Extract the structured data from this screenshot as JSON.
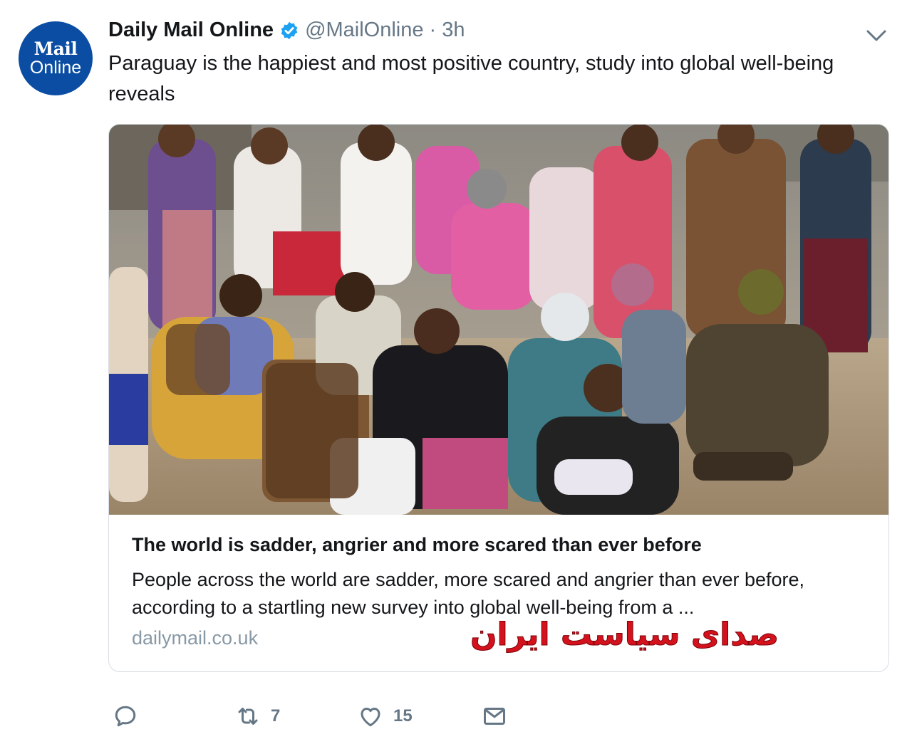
{
  "avatar": {
    "logo_top": "Mail",
    "logo_bottom": "Online",
    "color": "#0a4da2"
  },
  "header": {
    "display_name": "Daily Mail Online",
    "verified_icon": "verified-badge-icon",
    "handle": "@MailOnline",
    "separator": "·",
    "time": "3h",
    "menu_icon": "chevron-down-icon"
  },
  "tweet": {
    "text": "Paraguay is the happiest and most positive country, study into global well-being reveals"
  },
  "card": {
    "image_icon": "photo-crowd-image",
    "title": "The world is sadder, angrier and more scared than ever before",
    "description": "People across the world are sadder, more scared and angrier than ever before, according to a startling new survey into global well-being from a ...",
    "domain": "dailymail.co.uk"
  },
  "watermark": {
    "text": "صدای سیاست ایران",
    "color": "#d4121d"
  },
  "actions": {
    "reply_icon": "reply-icon",
    "reply_count": "",
    "retweet_icon": "retweet-icon",
    "retweet_count": "7",
    "like_icon": "heart-icon",
    "like_count": "15",
    "dm_icon": "envelope-icon"
  },
  "colors": {
    "secondary_text": "#657786",
    "verified": "#1da1f2"
  }
}
